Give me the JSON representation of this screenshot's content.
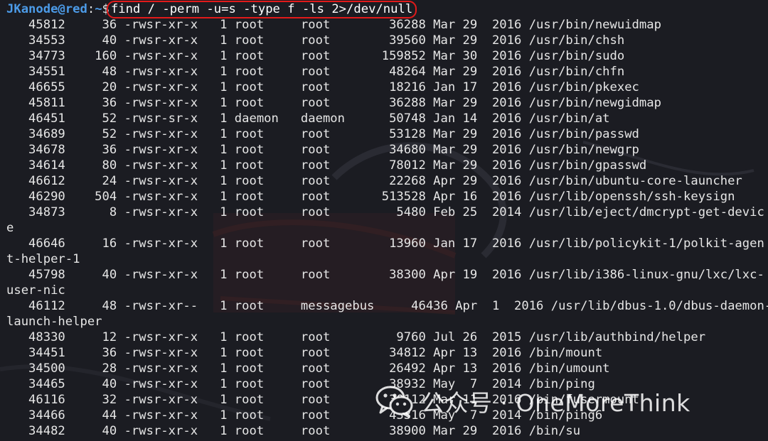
{
  "prompt": {
    "user_host": "JKanode@red",
    "separator": ":",
    "path": "~",
    "sign": "$",
    "command": "find / -perm -u=s -type f -ls 2>/dev/null"
  },
  "output_lines": [
    "   45812     36 -rwsr-xr-x   1 root     root        36288 Mar 29  2016 /usr/bin/newuidmap",
    "   34553     40 -rwsr-xr-x   1 root     root        39560 Mar 29  2016 /usr/bin/chsh",
    "   34773    160 -rwsr-xr-x   1 root     root       159852 Mar 30  2016 /usr/bin/sudo",
    "   34551     48 -rwsr-xr-x   1 root     root        48264 Mar 29  2016 /usr/bin/chfn",
    "   46655     20 -rwsr-xr-x   1 root     root        18216 Jan 17  2016 /usr/bin/pkexec",
    "   45811     36 -rwsr-xr-x   1 root     root        36288 Mar 29  2016 /usr/bin/newgidmap",
    "   46451     52 -rwsr-sr-x   1 daemon   daemon      50748 Jan 14  2016 /usr/bin/at",
    "   34689     52 -rwsr-xr-x   1 root     root        53128 Mar 29  2016 /usr/bin/passwd",
    "   34678     36 -rwsr-xr-x   1 root     root        34680 Mar 29  2016 /usr/bin/newgrp",
    "   34614     80 -rwsr-xr-x   1 root     root        78012 Mar 29  2016 /usr/bin/gpasswd",
    "   46612     24 -rwsr-xr-x   1 root     root        22268 Apr 29  2016 /usr/bin/ubuntu-core-launcher",
    "   46290    504 -rwsr-xr-x   1 root     root       513528 Apr 16  2016 /usr/lib/openssh/ssh-keysign",
    "   34873      8 -rwsr-xr-x   1 root     root         5480 Feb 25  2014 /usr/lib/eject/dmcrypt-get-devic",
    "e",
    "   46646     16 -rwsr-xr-x   1 root     root        13960 Jan 17  2016 /usr/lib/policykit-1/polkit-agen",
    "t-helper-1",
    "   45798     40 -rwsr-xr-x   1 root     root        38300 Apr 19  2016 /usr/lib/i386-linux-gnu/lxc/lxc-",
    "user-nic",
    "   46112     48 -rwsr-xr--   1 root     messagebus     46436 Apr  1  2016 /usr/lib/dbus-1.0/dbus-daemon-",
    "launch-helper",
    "   48330     12 -rwsr-xr-x   1 root     root         9760 Jul 26  2015 /usr/lib/authbind/helper",
    "   34451     36 -rwsr-xr-x   1 root     root        34812 Apr 13  2016 /bin/mount",
    "   34500     28 -rwsr-xr-x   1 root     root        26492 Apr 13  2016 /bin/umount",
    "   34465     40 -rwsr-xr-x   1 root     root        38932 May  7  2014 /bin/ping",
    "   46116     32 -rwsr-xr-x   1 root     root        30112 Mar 11  2016 /bin/fusermount",
    "   34466     44 -rwsr-xr-x   1 root     root        43316 May  7  2014 /bin/ping6",
    "   34482     40 -rwsr-xr-x   1 root     root        38900 Mar 29  2016 /bin/su"
  ],
  "watermark": {
    "text": "公众号 · OneMoreThink",
    "icon": "wechat-icon"
  },
  "colors": {
    "background": "#1b1c22",
    "prompt": "#4c9be8",
    "text": "#e6e6e6",
    "highlight_border": "#e21a1a"
  }
}
